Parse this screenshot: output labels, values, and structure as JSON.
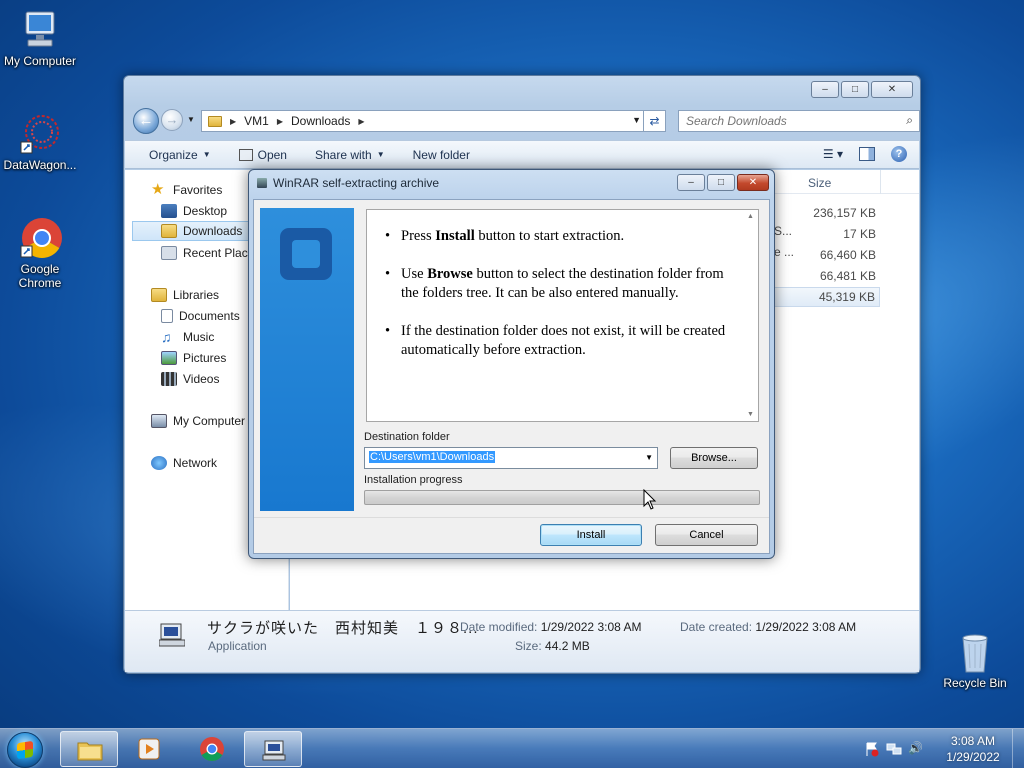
{
  "desktop": {
    "icons": [
      {
        "label": "My Computer"
      },
      {
        "label": "DataWagon..."
      },
      {
        "label": "Google Chrome"
      },
      {
        "label": "Recycle Bin"
      }
    ]
  },
  "explorer": {
    "breadcrumb": [
      "VM1",
      "Downloads"
    ],
    "search_placeholder": "Search Downloads",
    "toolbar": {
      "organize": "Organize",
      "open": "Open",
      "share_with": "Share with",
      "new_folder": "New folder"
    },
    "nav": {
      "favorites": "Favorites",
      "desktop": "Desktop",
      "downloads": "Downloads",
      "recent": "Recent Place",
      "libraries": "Libraries",
      "documents": "Documents",
      "music": "Music",
      "pictures": "Pictures",
      "videos": "Videos",
      "my_computer": "My Computer",
      "network": "Network"
    },
    "columns": {
      "size": "Size"
    },
    "files": [
      {
        "size": "236,157 KB",
        "frag": ""
      },
      {
        "size": "17 KB",
        "frag": "S..."
      },
      {
        "size": "66,460 KB",
        "frag": "e ..."
      },
      {
        "size": "66,481 KB",
        "frag": ""
      },
      {
        "size": "45,319 KB",
        "frag": ""
      }
    ],
    "details": {
      "filename": "サクラが咲いた　西村知美　１９８...",
      "type": "Application",
      "date_modified_label": "Date modified:",
      "date_modified": "1/29/2022 3:08 AM",
      "date_created_label": "Date created:",
      "date_created": "1/29/2022 3:08 AM",
      "size_label": "Size:",
      "size": "44.2 MB"
    }
  },
  "dialog": {
    "title": "WinRAR self-extracting archive",
    "info": {
      "p1_pre": "Press ",
      "p1_bold": "Install",
      "p1_post": " button to start extraction.",
      "p2_pre": "Use ",
      "p2_bold": "Browse",
      "p2_post": " button to select the destination folder from the folders tree. It can be also entered manually.",
      "p3": "If the destination folder does not exist, it will be created automatically before extraction."
    },
    "dest_label": "Destination folder",
    "dest_value": "C:\\Users\\vm1\\Downloads",
    "browse": "Browse...",
    "progress_label": "Installation progress",
    "progress_fraction": 0,
    "install": "Install",
    "cancel": "Cancel"
  },
  "taskbar": {
    "time": "3:08 AM",
    "date": "1/29/2022"
  }
}
